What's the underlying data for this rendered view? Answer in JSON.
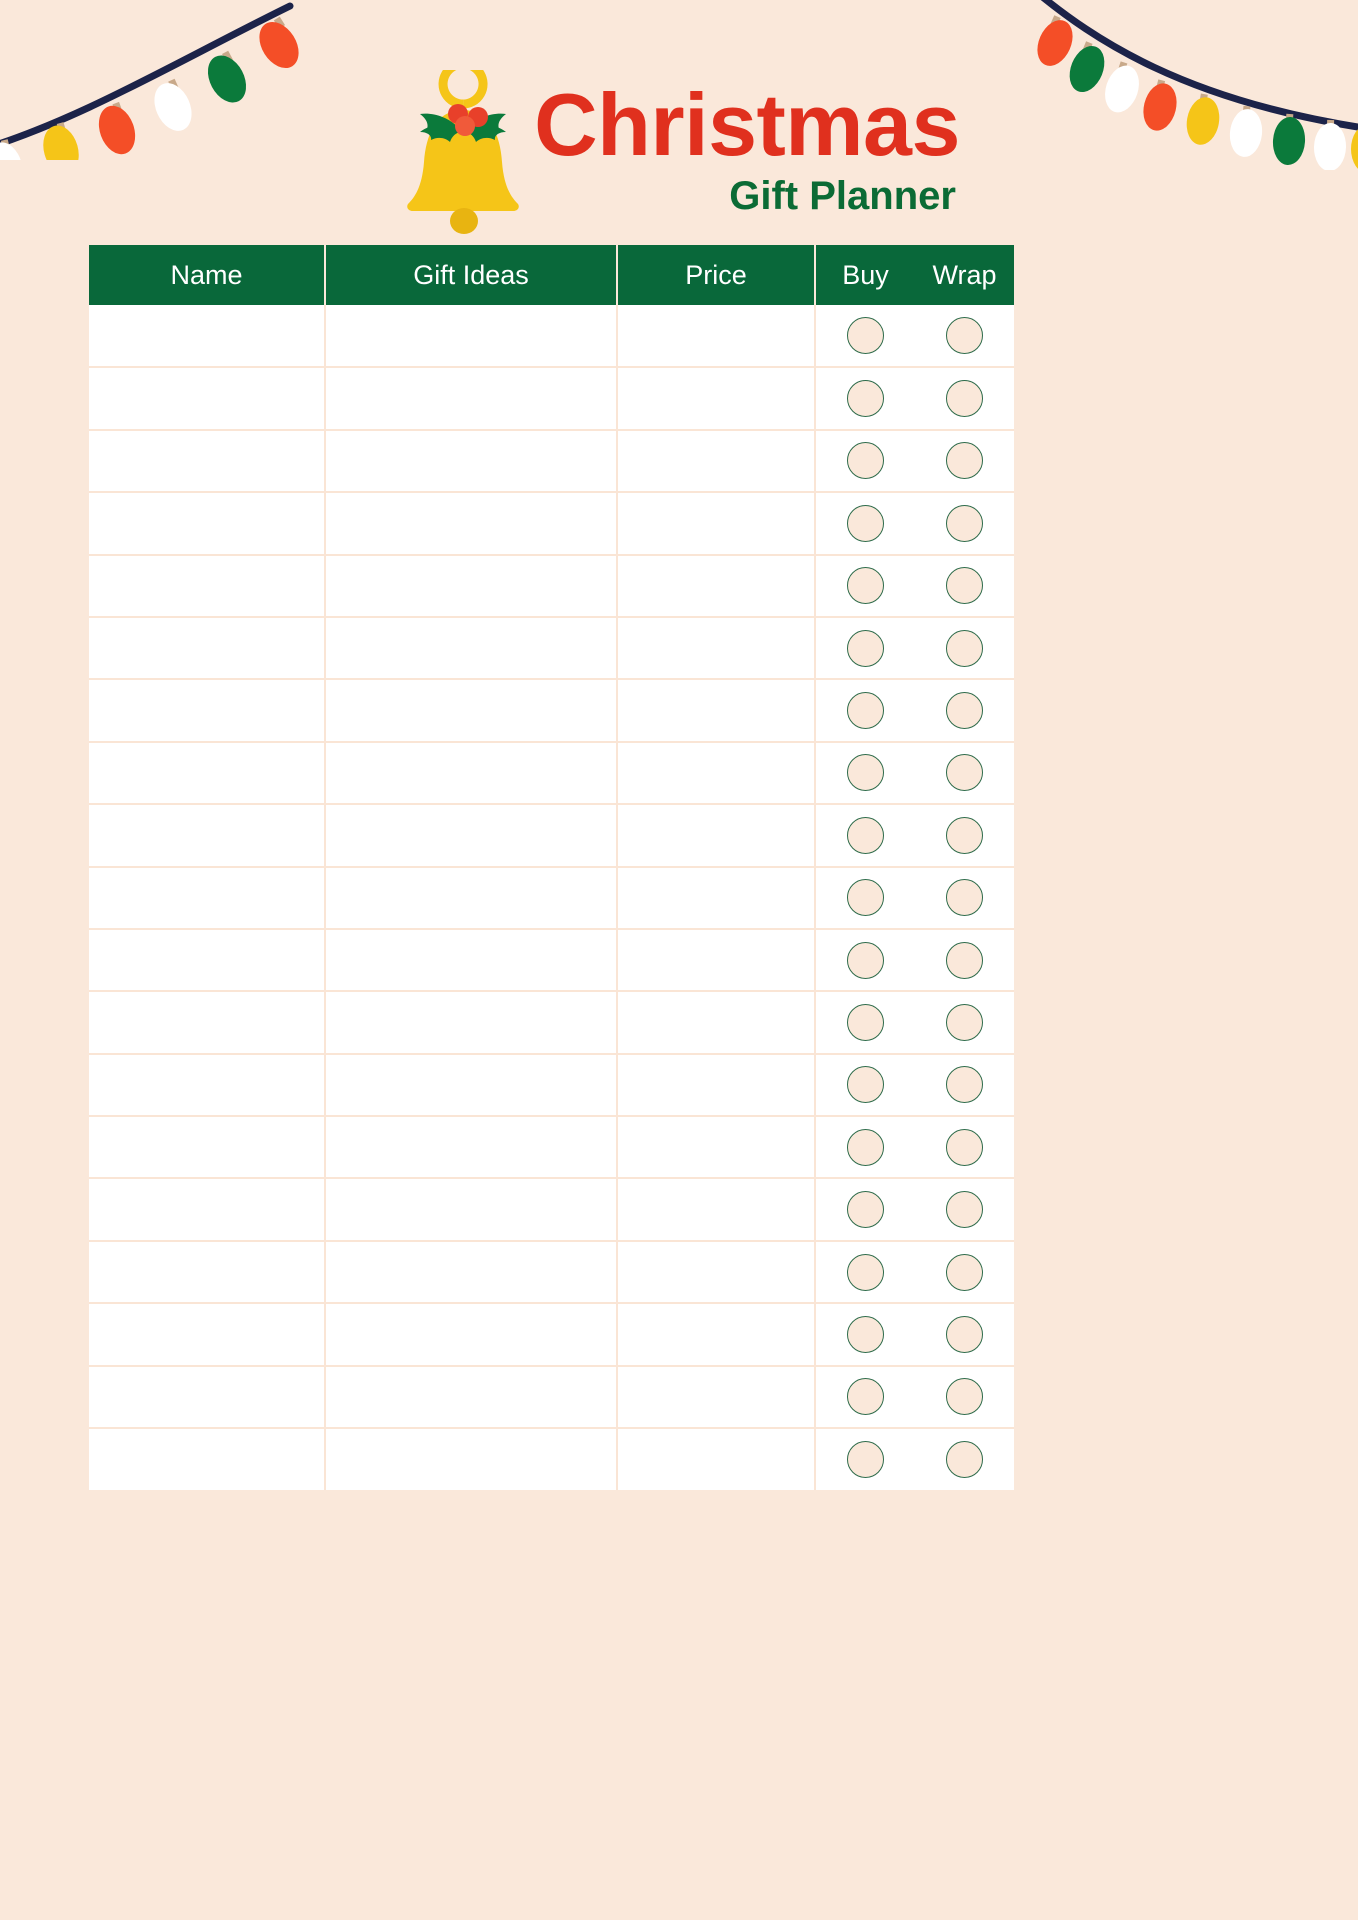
{
  "page": {
    "background_color": "#FAE8DA",
    "title_main": "Christmas",
    "title_sub": "Gift Planner",
    "title_main_color": "#E0301E",
    "title_sub_color": "#0B6B35"
  },
  "decorations": {
    "bell_icon": "christmas-bell-icon",
    "bell_color": "#F5C518",
    "holly_color": "#0B7A3B",
    "berry_color": "#E8402A",
    "garland_left": "christmas-lights-garland-left",
    "garland_right": "christmas-lights-garland-right",
    "wire_color": "#1C2349",
    "bulb_colors": [
      "#F44E27",
      "#0B7A3B",
      "#FFFFFF",
      "#F5C518"
    ]
  },
  "table": {
    "header_bg": "#09683A",
    "header_text_color": "#FFFFFF",
    "row_bg": "#FFFFFF",
    "divider_color": "#FAE5D5",
    "circle_fill": "#FAE8DA",
    "circle_border": "#2E6B4A",
    "columns": [
      {
        "key": "name",
        "label": "Name"
      },
      {
        "key": "gift",
        "label": "Gift Ideas"
      },
      {
        "key": "price",
        "label": "Price"
      },
      {
        "key": "buy",
        "label": "Buy"
      },
      {
        "key": "wrap",
        "label": "Wrap"
      }
    ],
    "row_count": 19,
    "rows": [
      {
        "name": "",
        "gift": "",
        "price": "",
        "buy": false,
        "wrap": false
      },
      {
        "name": "",
        "gift": "",
        "price": "",
        "buy": false,
        "wrap": false
      },
      {
        "name": "",
        "gift": "",
        "price": "",
        "buy": false,
        "wrap": false
      },
      {
        "name": "",
        "gift": "",
        "price": "",
        "buy": false,
        "wrap": false
      },
      {
        "name": "",
        "gift": "",
        "price": "",
        "buy": false,
        "wrap": false
      },
      {
        "name": "",
        "gift": "",
        "price": "",
        "buy": false,
        "wrap": false
      },
      {
        "name": "",
        "gift": "",
        "price": "",
        "buy": false,
        "wrap": false
      },
      {
        "name": "",
        "gift": "",
        "price": "",
        "buy": false,
        "wrap": false
      },
      {
        "name": "",
        "gift": "",
        "price": "",
        "buy": false,
        "wrap": false
      },
      {
        "name": "",
        "gift": "",
        "price": "",
        "buy": false,
        "wrap": false
      },
      {
        "name": "",
        "gift": "",
        "price": "",
        "buy": false,
        "wrap": false
      },
      {
        "name": "",
        "gift": "",
        "price": "",
        "buy": false,
        "wrap": false
      },
      {
        "name": "",
        "gift": "",
        "price": "",
        "buy": false,
        "wrap": false
      },
      {
        "name": "",
        "gift": "",
        "price": "",
        "buy": false,
        "wrap": false
      },
      {
        "name": "",
        "gift": "",
        "price": "",
        "buy": false,
        "wrap": false
      },
      {
        "name": "",
        "gift": "",
        "price": "",
        "buy": false,
        "wrap": false
      },
      {
        "name": "",
        "gift": "",
        "price": "",
        "buy": false,
        "wrap": false
      },
      {
        "name": "",
        "gift": "",
        "price": "",
        "buy": false,
        "wrap": false
      },
      {
        "name": "",
        "gift": "",
        "price": "",
        "buy": false,
        "wrap": false
      }
    ]
  }
}
